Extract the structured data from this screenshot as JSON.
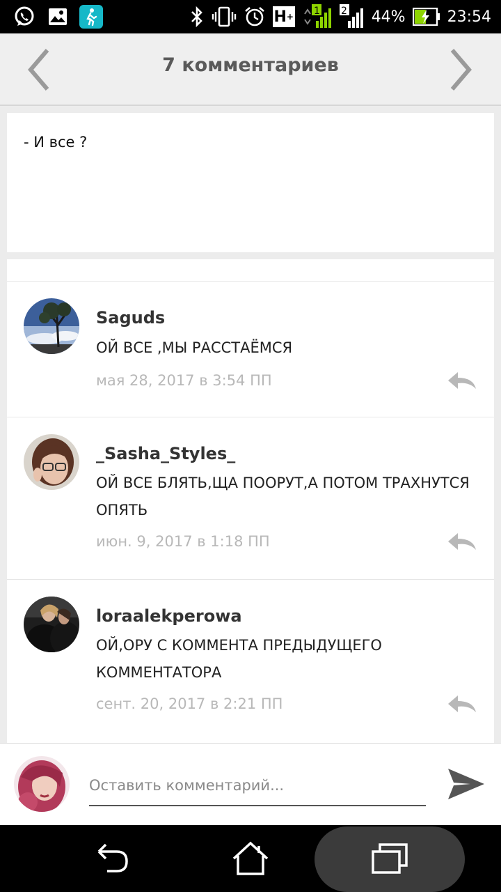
{
  "status_bar": {
    "battery": "44%",
    "time": "23:54",
    "network_type": "H",
    "icons": [
      "whatsapp-icon",
      "gallery-icon",
      "fitness-app-icon",
      "bluetooth-icon",
      "vibrate-icon",
      "alarm-icon",
      "signal-icon",
      "battery-icon"
    ]
  },
  "header": {
    "title": "7 комментариев",
    "prev_icon": "chevron-left-icon",
    "next_icon": "chevron-right-icon"
  },
  "post": {
    "text": "- И все ?"
  },
  "comments": [
    {
      "author": "Saguds",
      "text": "ОЙ ВСЕ ,МЫ РАССТАЁМСЯ",
      "date": "мая 28, 2017 в 3:54 ПП"
    },
    {
      "author": "_Sasha_Styles_",
      "text": "ОЙ ВСЕ БЛЯТЬ,ЩА ПООРУТ,А ПОТОМ ТРАХНУТСЯ ОПЯТЬ",
      "date": "июн. 9, 2017 в 1:18 ПП"
    },
    {
      "author": "loraalekperowa",
      "text": "ОЙ,ОРУ С КОММЕНТА ПРЕДЫДУЩЕГО КОММЕНТАТОРА",
      "date": "сент. 20, 2017 в 2:21 ПП"
    }
  ],
  "compose": {
    "placeholder": "Оставить комментарий...",
    "value": ""
  },
  "colors": {
    "header_bg": "#efefef",
    "title": "#5a5a5a",
    "date": "#b8b8b8",
    "battery_accent": "#8ed400"
  }
}
